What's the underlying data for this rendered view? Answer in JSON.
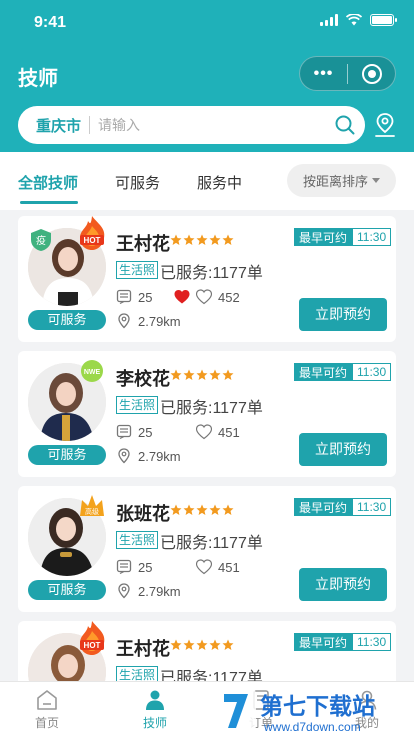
{
  "status_bar": {
    "time": "9:41"
  },
  "header": {
    "title": "技师",
    "capsule_more": "•••"
  },
  "search": {
    "city": "重庆市",
    "placeholder": "请输入"
  },
  "tabs": [
    {
      "label": "全部技师",
      "active": true
    },
    {
      "label": "可服务",
      "active": false
    },
    {
      "label": "服务中",
      "active": false
    }
  ],
  "sort": {
    "label": "按距离排序"
  },
  "cards": [
    {
      "name": "王村花",
      "rating": 5,
      "earliest_label": "最早可约",
      "earliest_time": "11:30",
      "license": "生活照",
      "served": "已服务:1177单",
      "comments": "25",
      "likes": "452",
      "distance": "2.79km",
      "status": "可服务",
      "button": "立即预约",
      "badge": "HOT",
      "shield": "疫"
    },
    {
      "name": "李校花",
      "rating": 5,
      "earliest_label": "最早可约",
      "earliest_time": "11:30",
      "license": "生活照",
      "served": "已服务:1177单",
      "comments": "25",
      "likes": "451",
      "distance": "2.79km",
      "status": "可服务",
      "button": "立即预约",
      "badge": "NWE"
    },
    {
      "name": "张班花",
      "rating": 5,
      "earliest_label": "最早可约",
      "earliest_time": "11:30",
      "license": "生活照",
      "served": "已服务:1177单",
      "comments": "25",
      "likes": "451",
      "distance": "2.79km",
      "status": "可服务",
      "button": "立即预约",
      "badge": "高级"
    },
    {
      "name": "王村花",
      "rating": 5,
      "earliest_label": "最早可约",
      "earliest_time": "11:30",
      "license": "生活照",
      "served": "已服务:1177单",
      "badge": "HOT"
    }
  ],
  "tabbar": [
    {
      "label": "首页",
      "icon": "home-icon",
      "active": false
    },
    {
      "label": "技师",
      "icon": "technician-icon",
      "active": true
    },
    {
      "label": "订单",
      "icon": "order-icon",
      "active": false
    },
    {
      "label": "我的",
      "icon": "profile-icon",
      "active": false
    }
  ],
  "colors": {
    "primary": "#1fb1b9",
    "accent": "#1fa3ac",
    "star": "#f29a1f",
    "heart": "#e02020"
  },
  "watermark": {
    "text": "第七下载站",
    "url": "www.d7down.com"
  }
}
